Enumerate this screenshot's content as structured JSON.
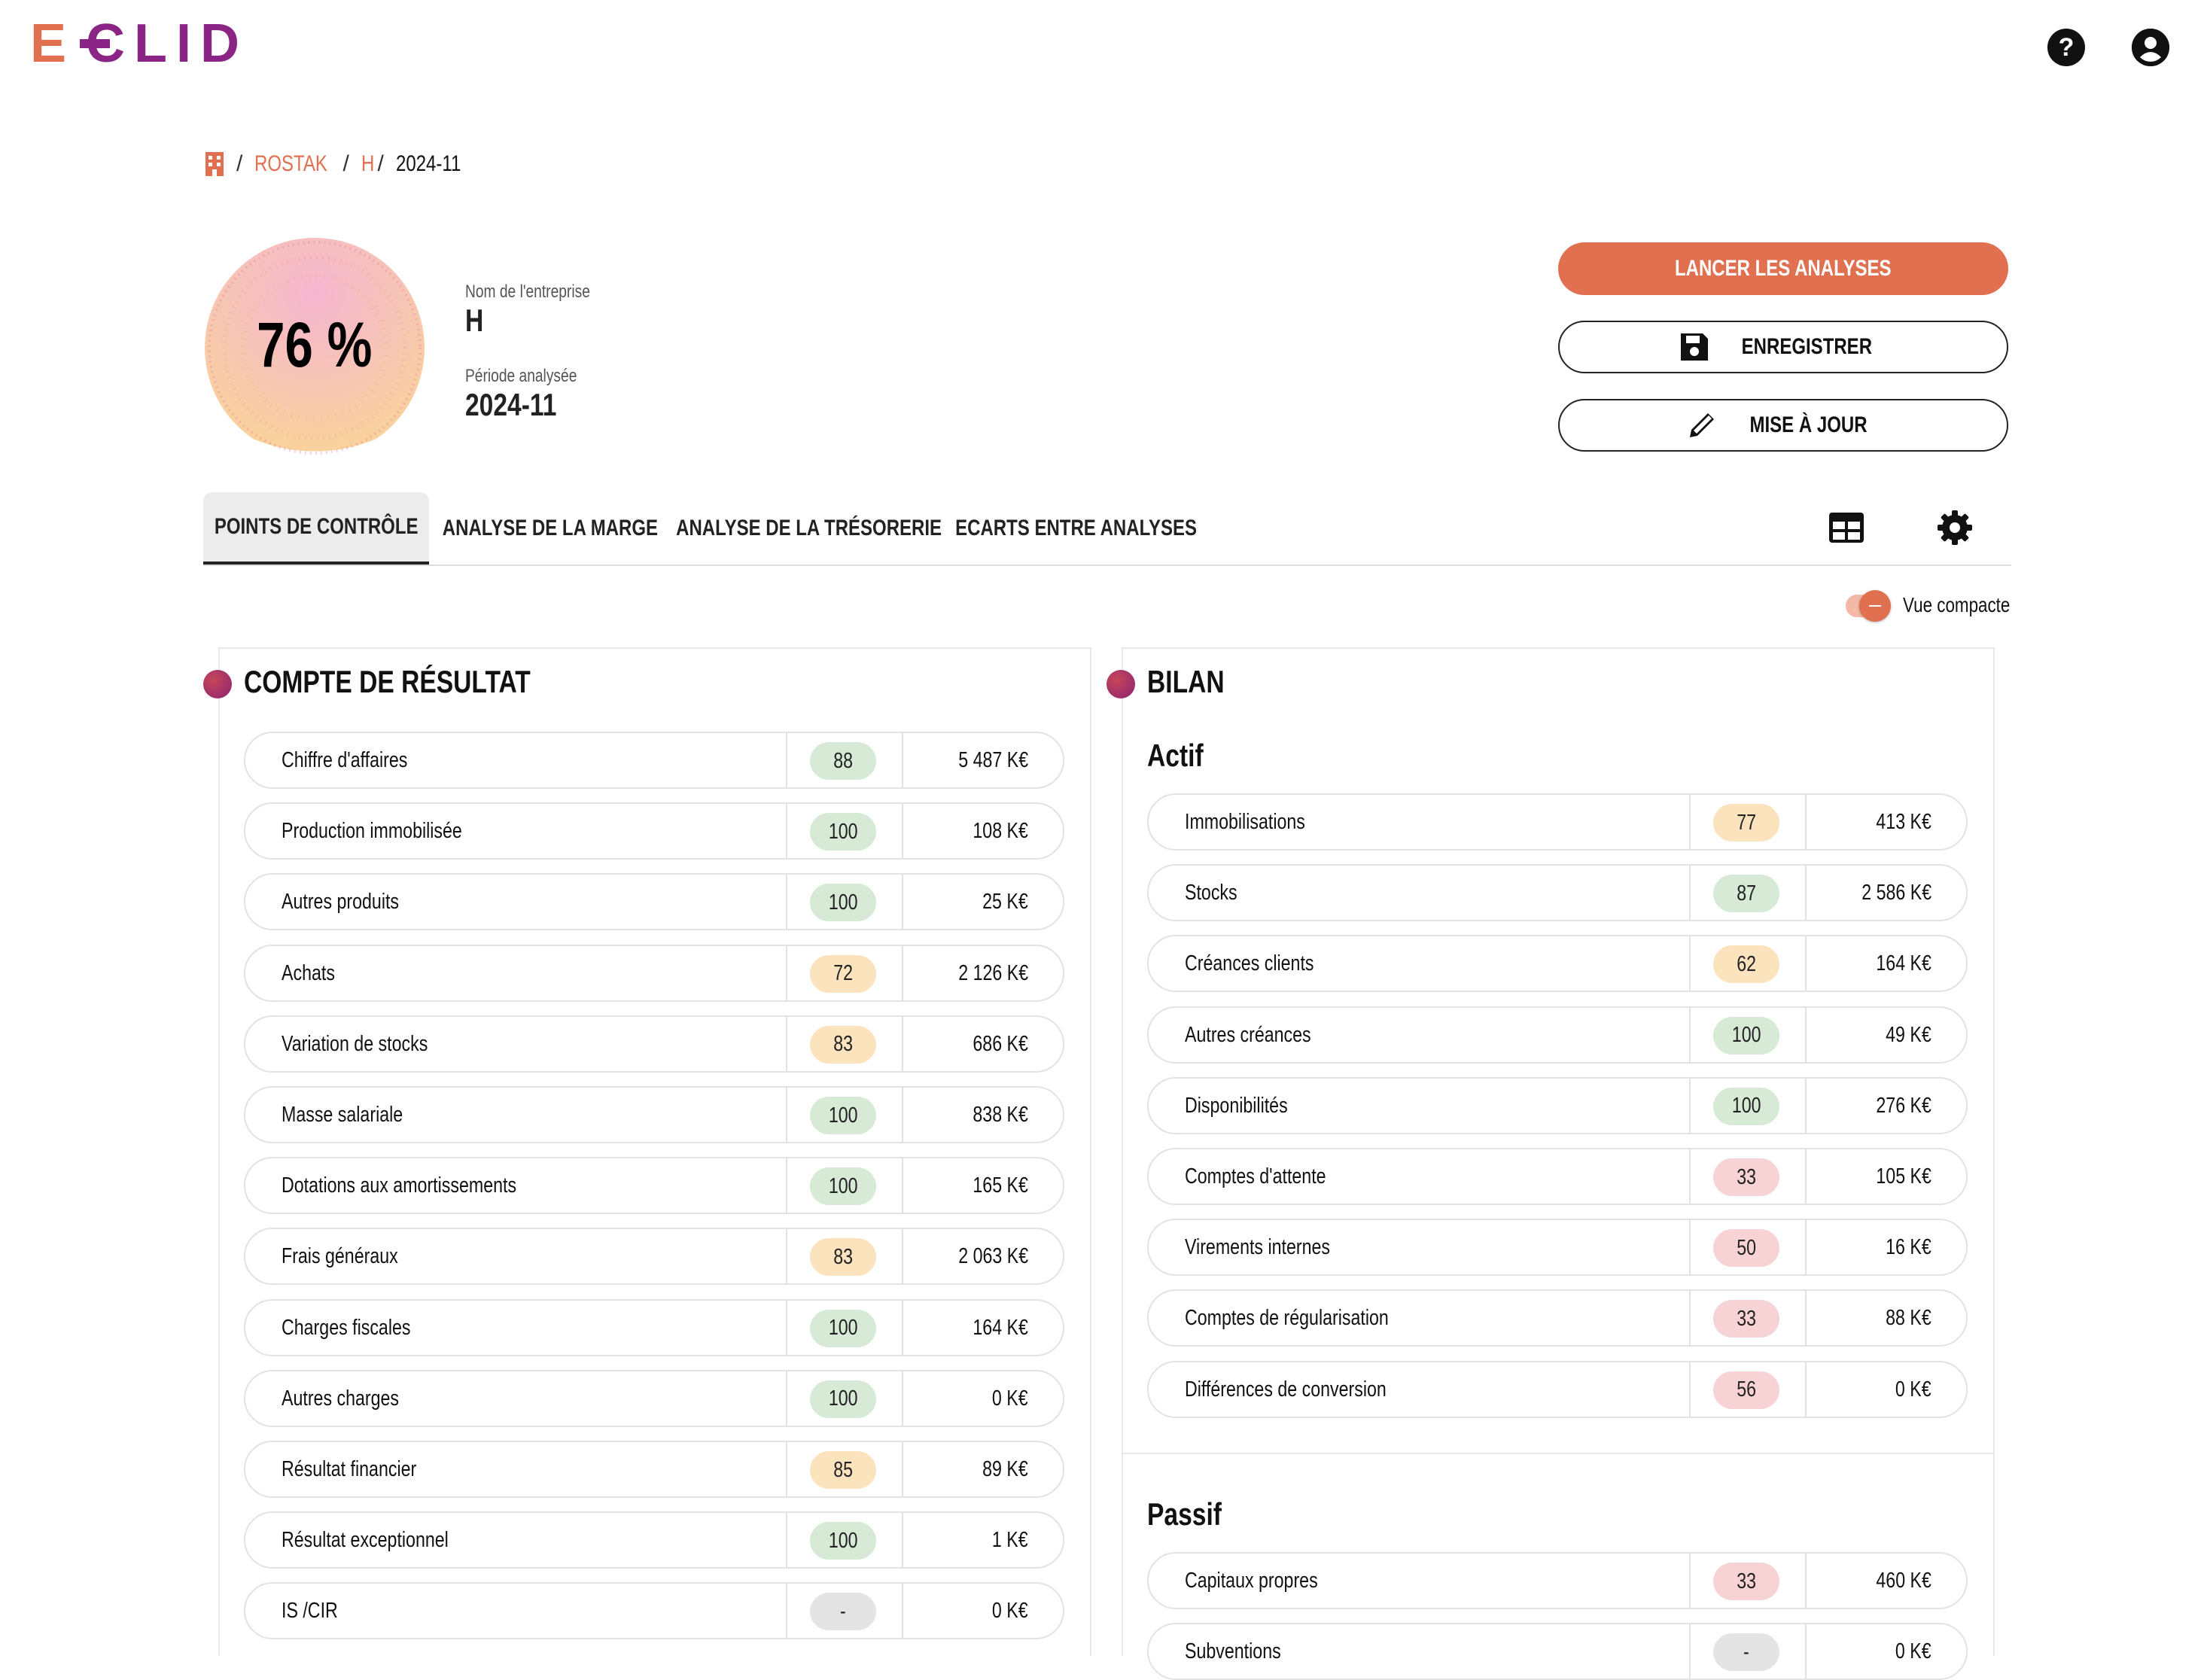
{
  "header": {
    "logo_e": "E",
    "logo_rest": "CLID",
    "help_icon": "?",
    "user_icon": "user-circle"
  },
  "breadcrumb": {
    "items": [
      "ROSTAK",
      "H",
      "2024-11"
    ]
  },
  "score": {
    "value": "76 %",
    "company_label": "Nom de l'entreprise",
    "company_value": "H",
    "period_label": "Période analysée",
    "period_value": "2024-11"
  },
  "actions": {
    "launch": "LANCER LES ANALYSES",
    "save": "ENREGISTRER",
    "update": "MISE À JOUR"
  },
  "tabs": [
    {
      "label": "POINTS DE CONTRÔLE",
      "active": true
    },
    {
      "label": "ANALYSE DE LA MARGE",
      "active": false
    },
    {
      "label": "ANALYSE DE LA TRÉSORERIE",
      "active": false
    },
    {
      "label": "ECARTS ENTRE ANALYSES",
      "active": false
    }
  ],
  "view_toggle": {
    "label": "Vue compacte",
    "on": true
  },
  "colors": {
    "accent": "#e07050",
    "brand_purple": "#8a2485",
    "green": "#d6ead6",
    "yellow": "#fbe3bd",
    "red": "#f8d3d6",
    "grey": "#e4e4e4"
  },
  "compte_resultat": {
    "title": "COMPTE DE RÉSULTAT",
    "rows": [
      {
        "label": "Chiffre d'affaires",
        "score": "88",
        "status": "green",
        "amount": "5 487 K€"
      },
      {
        "label": "Production immobilisée",
        "score": "100",
        "status": "green",
        "amount": "108 K€"
      },
      {
        "label": "Autres produits",
        "score": "100",
        "status": "green",
        "amount": "25 K€"
      },
      {
        "label": "Achats",
        "score": "72",
        "status": "yellow",
        "amount": "2 126 K€"
      },
      {
        "label": "Variation de stocks",
        "score": "83",
        "status": "yellow",
        "amount": "686 K€"
      },
      {
        "label": "Masse salariale",
        "score": "100",
        "status": "green",
        "amount": "838 K€"
      },
      {
        "label": "Dotations aux amortissements",
        "score": "100",
        "status": "green",
        "amount": "165 K€"
      },
      {
        "label": "Frais généraux",
        "score": "83",
        "status": "yellow",
        "amount": "2 063 K€"
      },
      {
        "label": "Charges fiscales",
        "score": "100",
        "status": "green",
        "amount": "164 K€"
      },
      {
        "label": "Autres charges",
        "score": "100",
        "status": "green",
        "amount": "0 K€"
      },
      {
        "label": "Résultat financier",
        "score": "85",
        "status": "yellow",
        "amount": "89 K€"
      },
      {
        "label": "Résultat exceptionnel",
        "score": "100",
        "status": "green",
        "amount": "1 K€"
      },
      {
        "label": "IS /CIR",
        "score": "-",
        "status": "grey",
        "amount": "0 K€"
      }
    ]
  },
  "bilan": {
    "title": "BILAN",
    "actif_title": "Actif",
    "actif_rows": [
      {
        "label": "Immobilisations",
        "score": "77",
        "status": "yellow",
        "amount": "413 K€"
      },
      {
        "label": "Stocks",
        "score": "87",
        "status": "green",
        "amount": "2 586 K€"
      },
      {
        "label": "Créances clients",
        "score": "62",
        "status": "yellow",
        "amount": "164 K€"
      },
      {
        "label": "Autres créances",
        "score": "100",
        "status": "green",
        "amount": "49 K€"
      },
      {
        "label": "Disponibilités",
        "score": "100",
        "status": "green",
        "amount": "276 K€"
      },
      {
        "label": "Comptes d'attente",
        "score": "33",
        "status": "red",
        "amount": "105 K€"
      },
      {
        "label": "Virements internes",
        "score": "50",
        "status": "red",
        "amount": "16 K€"
      },
      {
        "label": "Comptes de régularisation",
        "score": "33",
        "status": "red",
        "amount": "88 K€"
      },
      {
        "label": "Différences de conversion",
        "score": "56",
        "status": "red",
        "amount": "0 K€"
      }
    ],
    "passif_title": "Passif",
    "passif_rows": [
      {
        "label": "Capitaux propres",
        "score": "33",
        "status": "red",
        "amount": "460 K€"
      },
      {
        "label": "Subventions",
        "score": "-",
        "status": "grey",
        "amount": "0 K€"
      }
    ]
  }
}
